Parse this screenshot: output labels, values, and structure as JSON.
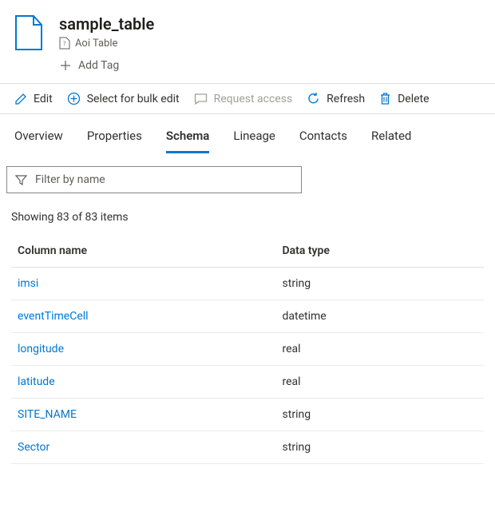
{
  "header": {
    "title": "sample_table",
    "subtype_label": "Aoi Table",
    "add_tag_label": "Add Tag"
  },
  "toolbar": {
    "edit": "Edit",
    "bulk": "Select for bulk edit",
    "request": "Request access",
    "refresh": "Refresh",
    "delete": "Delete"
  },
  "tabs": {
    "overview": "Overview",
    "properties": "Properties",
    "schema": "Schema",
    "lineage": "Lineage",
    "contacts": "Contacts",
    "related": "Related"
  },
  "filter": {
    "placeholder": "Filter by name"
  },
  "count_text": "Showing 83 of 83 items",
  "columns": {
    "name_header": "Column name",
    "type_header": "Data type"
  },
  "rows": [
    {
      "name": "imsi",
      "type": "string"
    },
    {
      "name": "eventTimeCell",
      "type": "datetime"
    },
    {
      "name": "longitude",
      "type": "real"
    },
    {
      "name": "latitude",
      "type": "real"
    },
    {
      "name": "SITE_NAME",
      "type": "string"
    },
    {
      "name": "Sector",
      "type": "string"
    }
  ]
}
